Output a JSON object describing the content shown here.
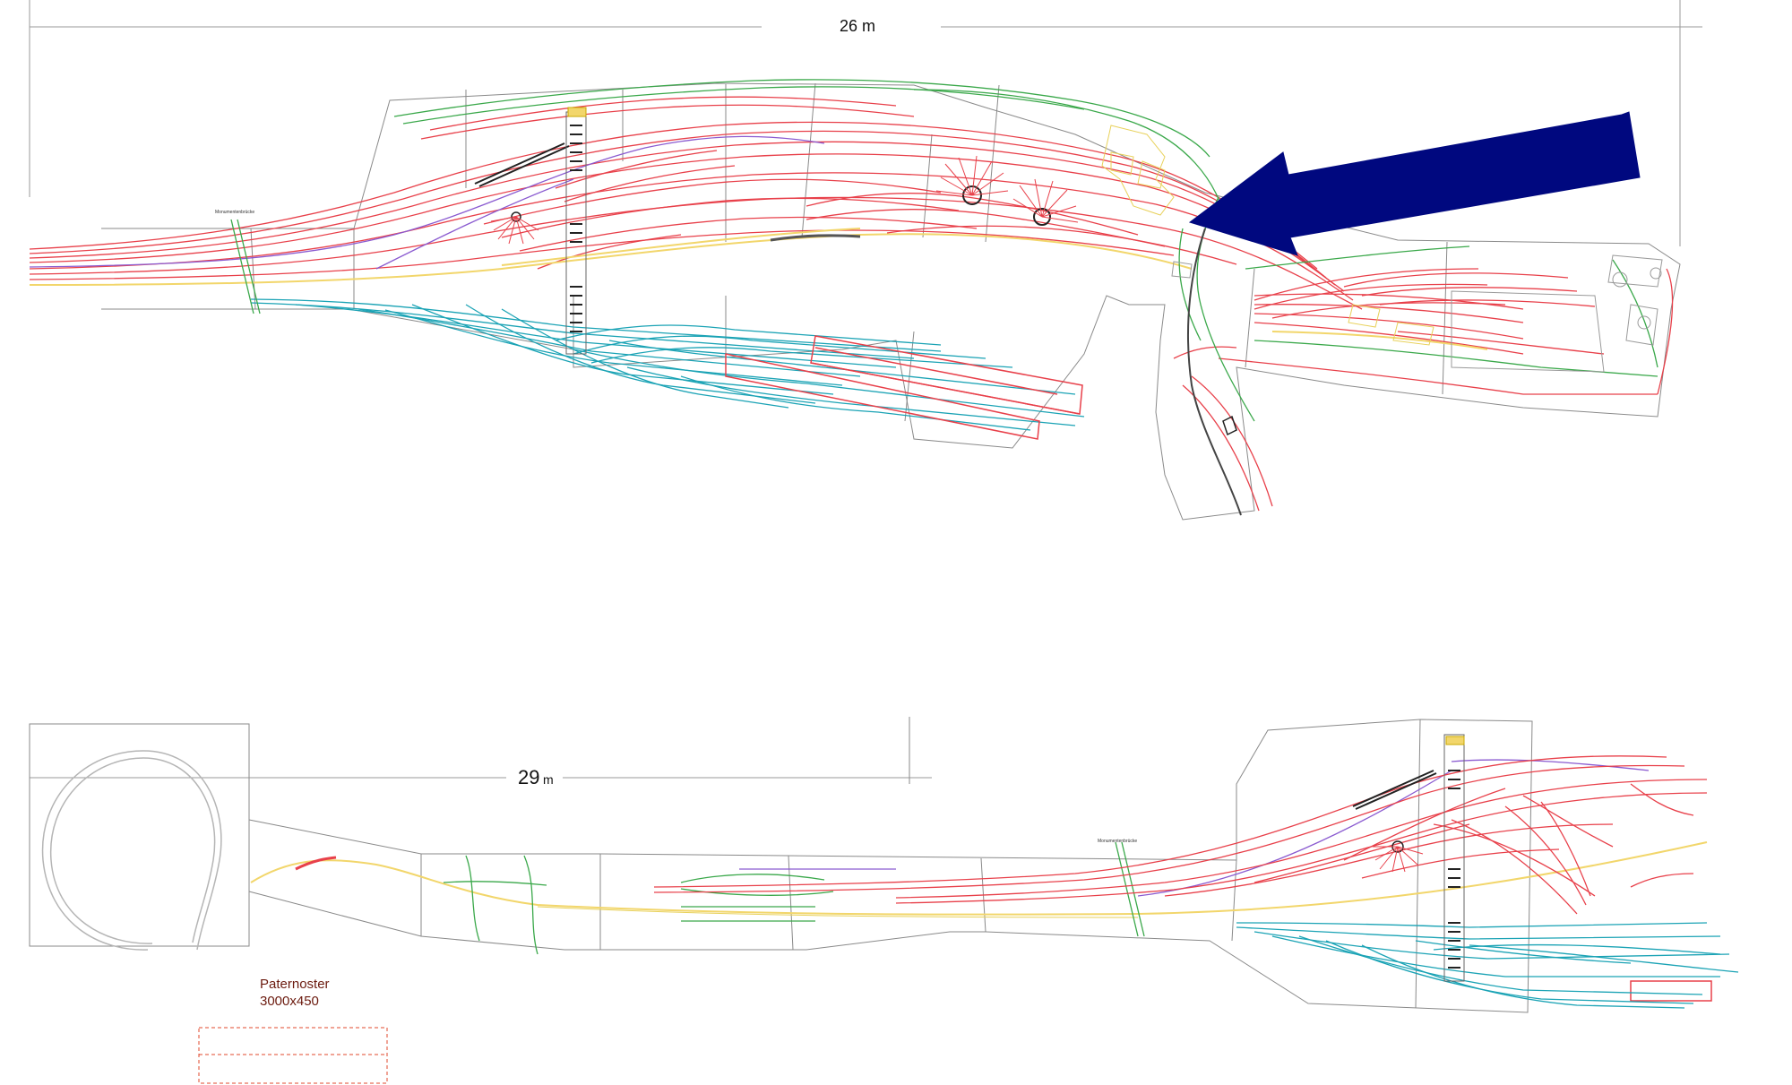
{
  "dimensions": {
    "top_length": "26 m",
    "bottom_length_value": "29",
    "bottom_length_unit": "m"
  },
  "bridge_label": "Monumentenbrücke",
  "paternoster": {
    "title": "Paternoster",
    "size": "3000x450"
  },
  "colors": {
    "main_track": "#e8404a",
    "yard_track": "#1ba3b5",
    "green_track": "#3aa84a",
    "purple_track": "#8a5ad0",
    "yellow_track": "#f2d66b",
    "outline": "#8a8a8a",
    "arrow": "#00087f",
    "paternoster_text": "#6b1a0e",
    "paternoster_box": "#e0492e"
  },
  "icons": {
    "arrow": "large-left-pointing-arrow-icon",
    "turntable": "turntable-icon"
  }
}
